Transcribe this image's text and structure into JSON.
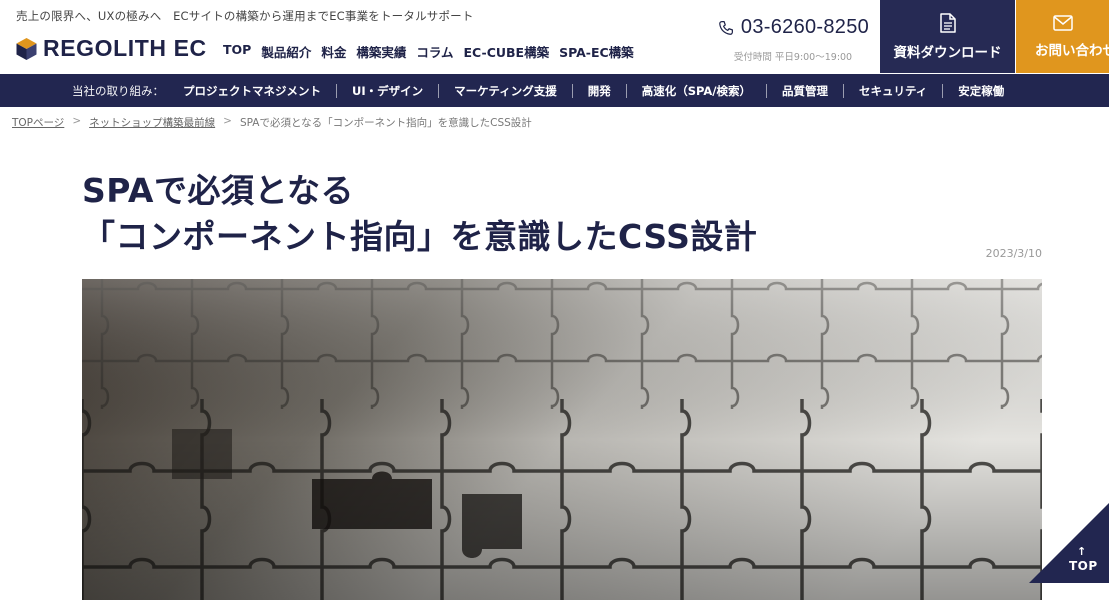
{
  "header": {
    "tagline": "売上の限界へ、UXの極みへ　ECサイトの構築から運用までEC事業をトータルサポート",
    "logo_text": "REGOLITH EC",
    "nav": [
      "TOP",
      "製品紹介",
      "料金",
      "構築実績",
      "コラム",
      "EC-CUBE構築",
      "SPA-EC構築"
    ],
    "phone_number": "03-6260-8250",
    "phone_hours": "受付時間 平日9:00〜19:00",
    "doc_button": "資料ダウンロード",
    "contact_button": "お問い合わせ"
  },
  "subnav": {
    "label": "当社の取り組み：",
    "items": [
      "プロジェクトマネジメント",
      "UI・デザイン",
      "マーケティング支援",
      "開発",
      "高速化（SPA/検索）",
      "品質管理",
      "セキュリティ",
      "安定稼働"
    ]
  },
  "breadcrumb": {
    "items": [
      "TOPページ",
      "ネットショップ構築最前線"
    ],
    "separator": ">",
    "current": "SPAで必須となる「コンポーネント指向」を意識したCSS設計"
  },
  "article": {
    "title_line1": "SPAで必須となる",
    "title_line2": "「コンポーネント指向」を意識したCSS設計",
    "date": "2023/3/10"
  },
  "to_top": {
    "arrow": "↑",
    "label": "TOP"
  },
  "colors": {
    "navy": "#222650",
    "orange": "#e0961e",
    "text": "#1f2348"
  }
}
